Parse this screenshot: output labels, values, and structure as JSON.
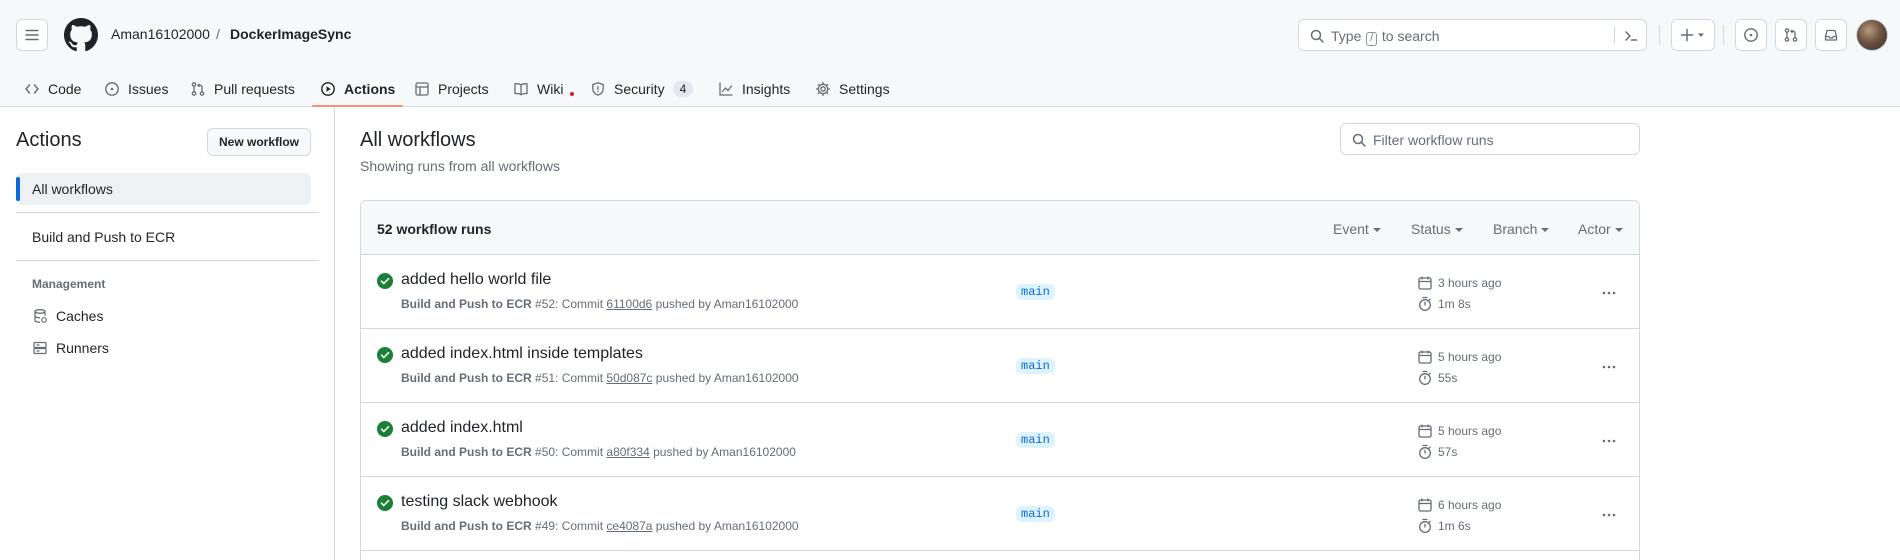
{
  "header": {
    "owner": "Aman16102000",
    "separator": "/",
    "repo": "DockerImageSync",
    "search_pre": "Type",
    "search_key": "/",
    "search_post": "to search"
  },
  "tabs": [
    {
      "label": "Code",
      "icon": "code-icon"
    },
    {
      "label": "Issues",
      "icon": "issue-opened-icon"
    },
    {
      "label": "Pull requests",
      "icon": "git-pull-request-icon"
    },
    {
      "label": "Actions",
      "icon": "play-icon"
    },
    {
      "label": "Projects",
      "icon": "table-icon"
    },
    {
      "label": "Wiki",
      "icon": "book-icon"
    },
    {
      "label": "Security",
      "icon": "shield-icon",
      "counter": "4"
    },
    {
      "label": "Insights",
      "icon": "graph-icon"
    },
    {
      "label": "Settings",
      "icon": "gear-icon"
    }
  ],
  "sidebar": {
    "title": "Actions",
    "new_workflow": "New workflow",
    "items": [
      {
        "label": "All workflows"
      },
      {
        "label": "Build and Push to ECR"
      }
    ],
    "management_heading": "Management",
    "management": [
      {
        "label": "Caches",
        "icon": "database-icon"
      },
      {
        "label": "Runners",
        "icon": "server-icon"
      }
    ]
  },
  "main": {
    "title": "All workflows",
    "subtitle": "Showing runs from all workflows",
    "filter_placeholder": "Filter workflow runs",
    "count": "52 workflow runs",
    "filters": [
      "Event",
      "Status",
      "Branch",
      "Actor"
    ]
  },
  "runs": [
    {
      "title": "added hello world file",
      "workflow": "Build and Push to ECR",
      "run": "#52: Commit",
      "commit": "61100d6",
      "pushed": "pushed by Aman16102000",
      "branch": "main",
      "when": "3 hours ago",
      "duration": "1m 8s"
    },
    {
      "title": "added index.html inside templates",
      "workflow": "Build and Push to ECR",
      "run": "#51: Commit",
      "commit": "50d087c",
      "pushed": "pushed by Aman16102000",
      "branch": "main",
      "when": "5 hours ago",
      "duration": "55s"
    },
    {
      "title": "added index.html",
      "workflow": "Build and Push to ECR",
      "run": "#50: Commit",
      "commit": "a80f334",
      "pushed": "pushed by Aman16102000",
      "branch": "main",
      "when": "5 hours ago",
      "duration": "57s"
    },
    {
      "title": "testing slack webhook",
      "workflow": "Build and Push to ECR",
      "run": "#49: Commit",
      "commit": "ce4087a",
      "pushed": "pushed by Aman16102000",
      "branch": "main",
      "when": "6 hours ago",
      "duration": "1m 6s"
    }
  ],
  "colors": {
    "success": "#1a7f37",
    "accent": "#0969da",
    "active_tab_underline": "#fd8c73"
  }
}
